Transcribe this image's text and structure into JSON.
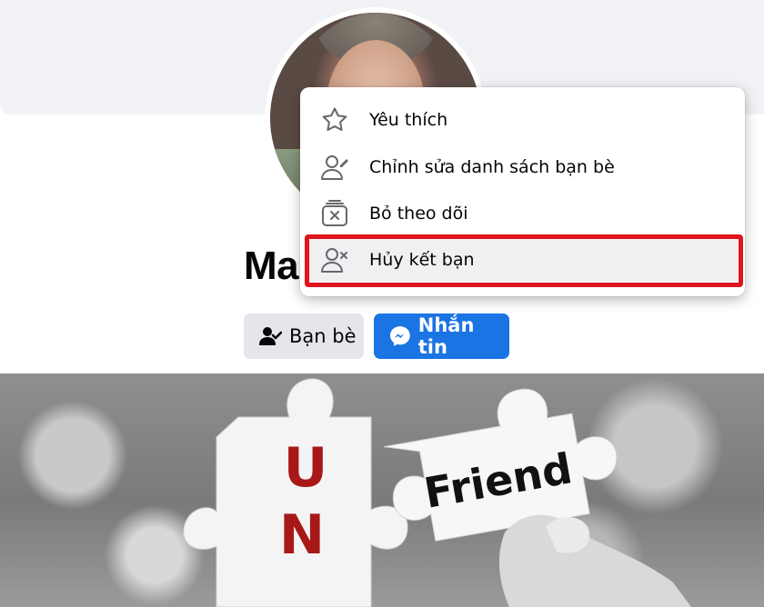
{
  "profile": {
    "name_partial": "Ma"
  },
  "buttons": {
    "friends_label": "Bạn bè",
    "message_label": "Nhắn tin"
  },
  "menu": {
    "items": [
      {
        "icon": "star-icon",
        "label": "Yêu thích"
      },
      {
        "icon": "edit-friend-list-icon",
        "label": "Chỉnh sửa danh sách bạn bè"
      },
      {
        "icon": "unfollow-icon",
        "label": "Bỏ theo dõi"
      },
      {
        "icon": "unfriend-icon",
        "label": "Hủy kết bạn"
      }
    ],
    "highlighted_index": 3,
    "highlight_color": "#e0141c"
  },
  "photo": {
    "letter_1": "U",
    "letter_2": "N",
    "word": "Friend"
  },
  "colors": {
    "accent": "#1b74e4",
    "button_gray": "#e4e6eb",
    "cover_gray": "#f0f2f5"
  }
}
